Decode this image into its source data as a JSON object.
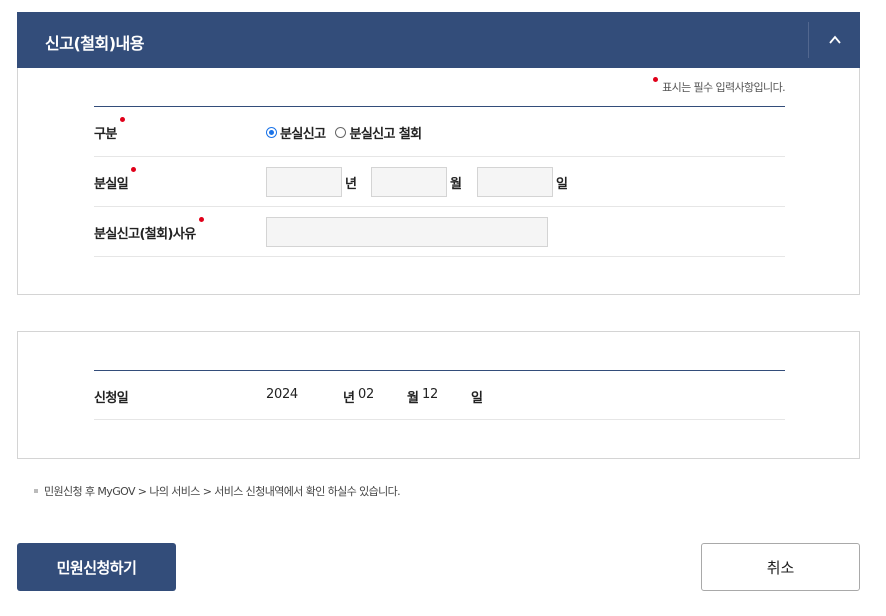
{
  "section": {
    "title": "신고(철회)내용",
    "required_note": "표시는 필수 입력사항입니다."
  },
  "form": {
    "type_label": "구분",
    "type_options": [
      "분실신고",
      "분실신고 철회"
    ],
    "type_selected": "분실신고",
    "lost_date_label": "분실일",
    "year_unit": "년",
    "month_unit": "월",
    "day_unit": "일",
    "year_value": "",
    "month_value": "",
    "day_value": "",
    "reason_label": "분실신고(철회)사유",
    "reason_value": ""
  },
  "application": {
    "label": "신청일",
    "year": "2024",
    "year_unit": "년",
    "month": "02",
    "month_unit": "월",
    "day": "12",
    "day_unit": "일"
  },
  "notice": "민원신청 후 MyGOV > 나의 서비스 > 서비스 신청내역에서 확인 하실수 있습니다.",
  "buttons": {
    "submit": "민원신청하기",
    "cancel": "취소"
  },
  "colors": {
    "header_bg": "#334d7a",
    "required_dot": "#e0001a",
    "radio_checked": "#1a73e8"
  },
  "icons": {
    "collapse": "chevron-up-icon"
  }
}
